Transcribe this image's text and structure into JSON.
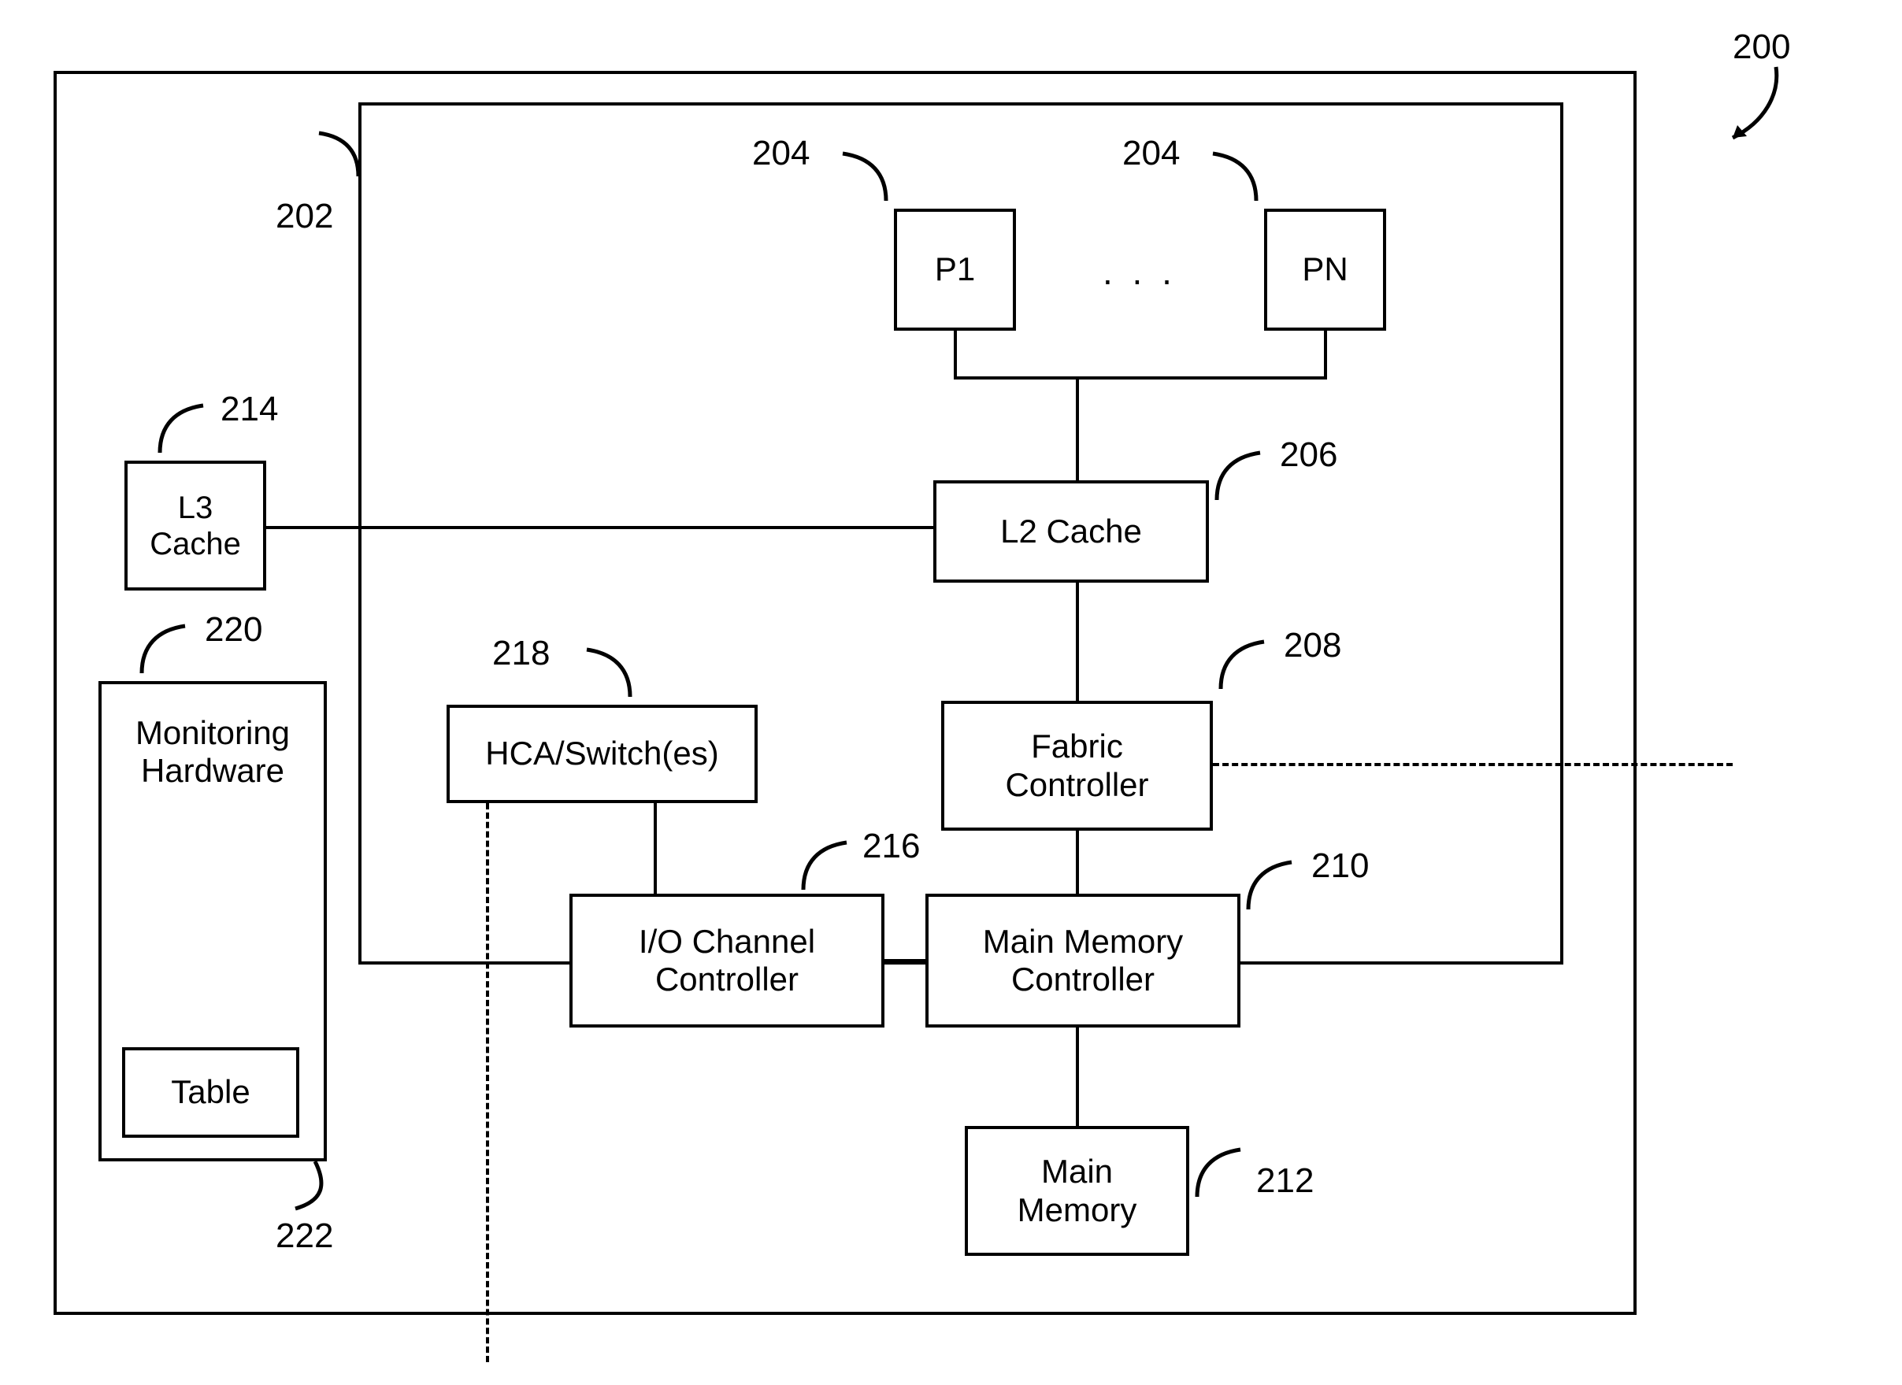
{
  "refs": {
    "system": "200",
    "chip": "202",
    "proc1": "204",
    "procN": "204",
    "l2": "206",
    "fabric": "208",
    "mmc": "210",
    "mainmem": "212",
    "l3": "214",
    "ioc": "216",
    "hca": "218",
    "mon": "220",
    "table": "222"
  },
  "blocks": {
    "p1": "P1",
    "pn": "PN",
    "ellipsis": ". . .",
    "l2": "L2 Cache",
    "fabric": "Fabric\nController",
    "mmc": "Main Memory\nController",
    "mainmem": "Main\nMemory",
    "l3": "L3\nCache",
    "ioc": "I/O Channel\nController",
    "hca": "HCA/Switch(es)",
    "mon": "Monitoring\nHardware",
    "table": "Table"
  }
}
